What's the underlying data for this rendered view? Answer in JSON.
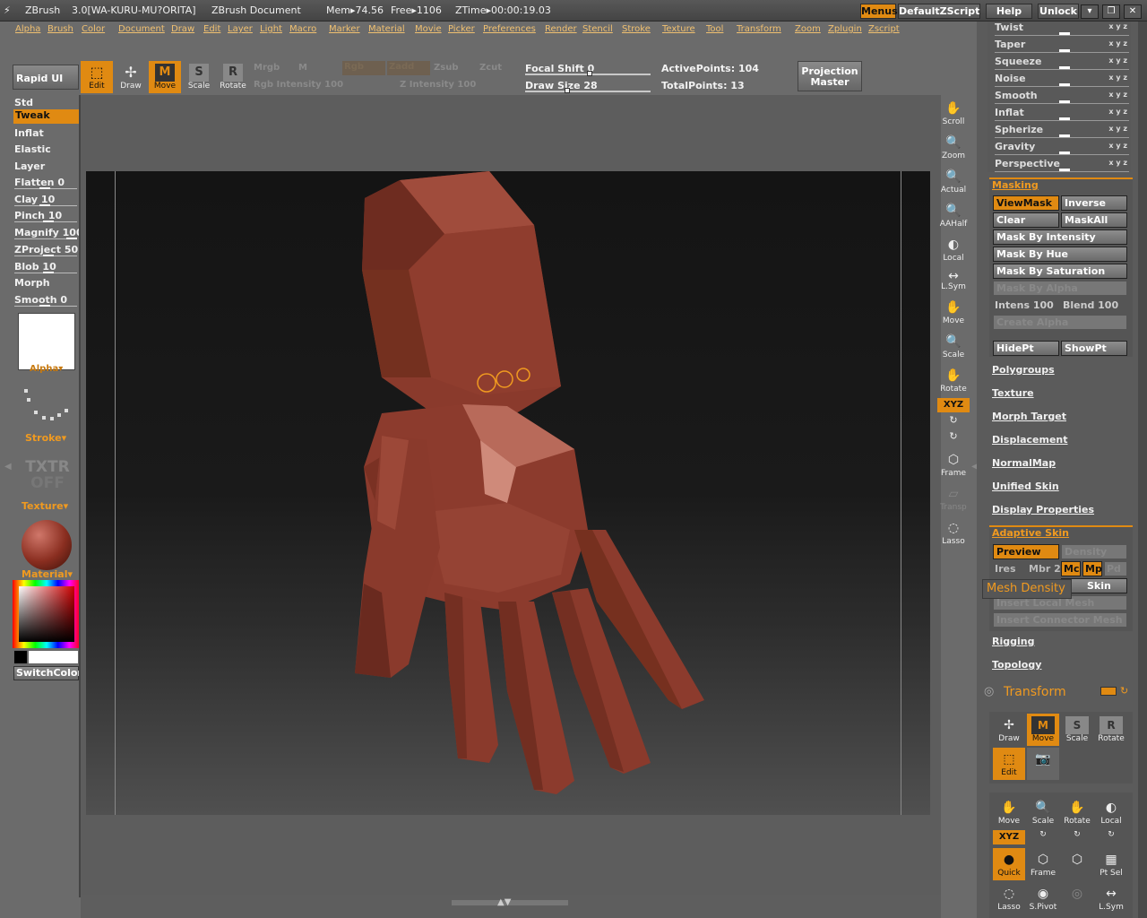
{
  "titlebar": {
    "app": "ZBrush",
    "version": "3.0[WA-KURU-MU?ORITA]",
    "document": "ZBrush Document",
    "mem": "Mem▸74.56",
    "free": "Free▸1106",
    "ztime": "ZTime▸00:00:19.03",
    "menus_label": "Menus",
    "script_label": "DefaultZScript",
    "help_label": "Help",
    "unlock_label": "Unlock"
  },
  "menubar": [
    "Alpha",
    "Brush",
    "Color",
    "Document",
    "Draw",
    "Edit",
    "Layer",
    "Light",
    "Macro",
    "Marker",
    "Material",
    "Movie",
    "Picker",
    "Preferences",
    "Render",
    "Stencil",
    "Stroke",
    "Texture",
    "Tool",
    "Transform",
    "Zoom",
    "Zplugin",
    "Zscript"
  ],
  "shelf": {
    "rapid_ui": "Rapid UI",
    "edit": "Edit",
    "draw": "Draw",
    "move": "Move",
    "scale": "Scale",
    "rotate": "Rotate",
    "mrgb": "Mrgb",
    "m": "M",
    "rgb": "Rgb",
    "zadd": "Zadd",
    "zsub": "Zsub",
    "zcut": "Zcut",
    "rgb_intensity": "Rgb Intensity 100",
    "z_intensity": "Z Intensity 100",
    "focal_shift": "Focal Shift 0",
    "draw_size": "Draw Size 28",
    "active_points": "ActivePoints: 104",
    "total_points": "TotalPoints: 13",
    "projection_master": "Projection",
    "projection_master2": "Master"
  },
  "left": {
    "std": "Std",
    "tweak": "Tweak",
    "inflat": "Inflat",
    "elastic": "Elastic",
    "layer": "Layer",
    "flatten": "Flatten 0",
    "clay": "Clay 10",
    "pinch": "Pinch 10",
    "magnify": "Magnify 100",
    "zproject": "ZProject 50",
    "blob": "Blob 10",
    "morph": "Morph",
    "smooth": "Smooth 0",
    "alpha": "Alpha▾",
    "stroke": "Stroke▾",
    "txtr_off_1": "TXTR",
    "txtr_off_2": "OFF",
    "texture": "Texture▾",
    "material": "Material▾",
    "switch_color": "SwitchColor"
  },
  "rightshelf": {
    "scroll": "Scroll",
    "zoom": "Zoom",
    "actual": "Actual",
    "aahalf": "AAHalf",
    "local": "Local",
    "lsym": "L.Sym",
    "move": "Move",
    "scale": "Scale",
    "rotate": "Rotate",
    "xyz": "XYZ",
    "frame": "Frame",
    "transp": "Transp",
    "lasso": "Lasso"
  },
  "deformation": [
    {
      "label": "Twist",
      "axes": "x y z"
    },
    {
      "label": "Taper",
      "axes": "x y z"
    },
    {
      "label": "Squeeze",
      "axes": "x y z"
    },
    {
      "label": "Noise",
      "axes": "x y z"
    },
    {
      "label": "Smooth",
      "axes": "x y z"
    },
    {
      "label": "Inflat",
      "axes": "x y z"
    },
    {
      "label": "Spherize",
      "axes": "x y z"
    },
    {
      "label": "Gravity",
      "axes": "x y z"
    },
    {
      "label": "Perspective",
      "axes": "x y z"
    }
  ],
  "masking": {
    "title": "Masking",
    "viewmask": "ViewMask",
    "inverse": "Inverse",
    "clear": "Clear",
    "maskall": "MaskAll",
    "by_intensity": "Mask By Intensity",
    "by_hue": "Mask By Hue",
    "by_saturation": "Mask By Saturation",
    "by_alpha": "Mask By Alpha",
    "intens": "Intens 100",
    "blend": "Blend 100",
    "create_alpha": "Create Alpha",
    "hidept": "HidePt",
    "showpt": "ShowPt"
  },
  "tool_sections": [
    "Polygroups",
    "Texture",
    "Morph Target",
    "Displacement",
    "NormalMap",
    "Unified Skin",
    "Display Properties"
  ],
  "adaptive": {
    "title": "Adaptive Skin",
    "preview": "Preview",
    "density": "Density",
    "ires": "Ires",
    "mbr": "Mbr 2",
    "mc": "Mc",
    "mp": "Mp",
    "pd": "Pd",
    "skin": "Skin",
    "insert_local": "Insert Local Mesh",
    "insert_connector": "Insert Connector Mesh",
    "tooltip": "Mesh Density"
  },
  "more_sections": [
    "Rigging",
    "Topology"
  ],
  "transform_panel": {
    "title": "Transform",
    "draw": "Draw",
    "move": "Move",
    "scale": "Scale",
    "rotate": "Rotate",
    "edit": "Edit",
    "move2": "Move",
    "scale2": "Scale",
    "rotate2": "Rotate",
    "local": "Local",
    "xyz": "XYZ",
    "quick": "Quick",
    "frame": "Frame",
    "ptsel": "Pt Sel",
    "lasso": "Lasso",
    "spivot": "S.Pivot",
    "lsym": "L.Sym"
  },
  "colors": {
    "accent": "#e08a12",
    "model": "#8a3a2c"
  }
}
